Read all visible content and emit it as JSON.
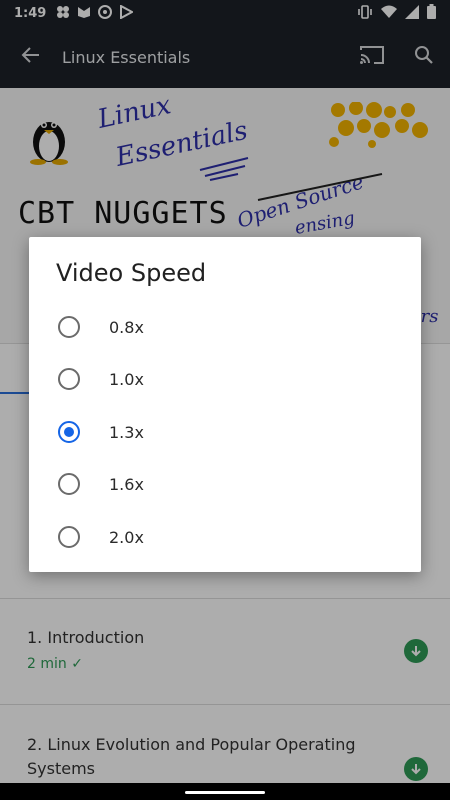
{
  "status_bar": {
    "time": "1:49",
    "left_icons": [
      "pinwheel-icon",
      "chat-icon",
      "media-icon",
      "play-store-icon"
    ],
    "right_icons": [
      "vibrate-icon",
      "wifi-icon",
      "signal-icon",
      "battery-icon"
    ]
  },
  "app_bar": {
    "title": "Linux Essentials",
    "actions": [
      "cast-icon",
      "search-icon"
    ]
  },
  "video": {
    "brand_text": "CBT NUGGETS",
    "handwriting_1": "Linux",
    "handwriting_2": "Essentials",
    "handwriting_3": "Open Source",
    "handwriting_4": "ensing",
    "handwriting_5": "ers"
  },
  "course_list": {
    "items": [
      {
        "title": "1. Introduction",
        "meta": "2 min ✓"
      },
      {
        "title_line1": "2. Linux Evolution and Popular Operating",
        "title_line2": "Systems"
      }
    ]
  },
  "dialog": {
    "title": "Video Speed",
    "options": [
      {
        "label": "0.8x",
        "selected": false
      },
      {
        "label": "1.0x",
        "selected": false
      },
      {
        "label": "1.3x",
        "selected": true
      },
      {
        "label": "1.6x",
        "selected": false
      },
      {
        "label": "2.0x",
        "selected": false
      }
    ]
  },
  "colors": {
    "accent": "#1565e6",
    "success": "#2e9a56",
    "app_bar": "#1d2128"
  }
}
